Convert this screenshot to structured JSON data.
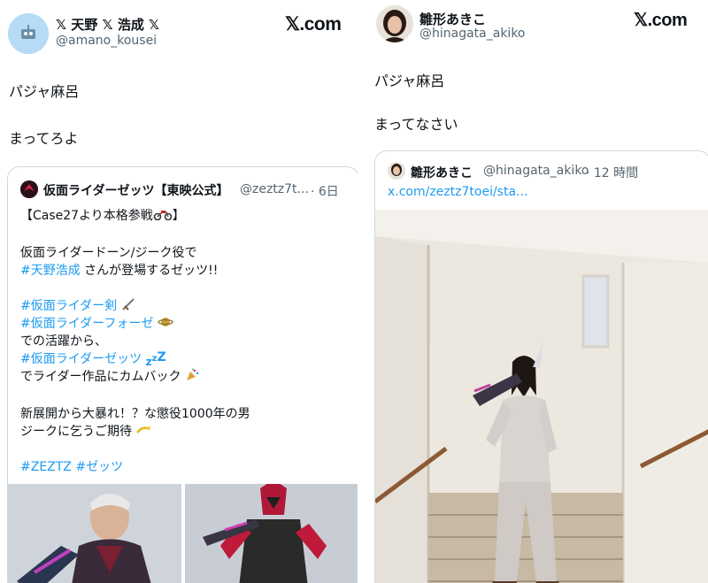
{
  "left_post": {
    "display_name": "𝕏 天野 𝕏 浩成 𝕏",
    "handle": "@amano_kousei",
    "brand": "𝕏.com",
    "text_lines": [
      "パジャ麻呂",
      "まってろよ"
    ],
    "quote": {
      "display_name": "仮面ライダーゼッツ【東映公式】",
      "handle": "@zeztz7t...",
      "time": "· 6日",
      "line1": "【Case27より本格参戦",
      "line1_end": "】",
      "line2": "仮面ライダードーン/ジーク役で",
      "line3_tag": "#天野浩成",
      "line3_rest": " さんが登場するゼッツ!!",
      "line4_tag": "#仮面ライダー剣",
      "line5_tag": "#仮面ライダーフォーゼ",
      "line6": "での活躍から、",
      "line7_tag": "#仮面ライダーゼッツ",
      "line8": "でライダー作品にカムバック",
      "line9": "新展開から大暴れ！？な懲役1000年の男",
      "line10": "ジークに乞うご期待",
      "line11_tags": "#ZEZTZ #ゼッツ"
    }
  },
  "right_post": {
    "display_name": "雛形あきこ",
    "handle": "@hinagata_akiko",
    "brand": "𝕏.com",
    "text_lines": [
      "パジャ麻呂",
      "まってなさい"
    ],
    "quote": {
      "display_name": "雛形あきこ",
      "handle": "@hinagata_akiko",
      "time": "· 12 時間",
      "link": "x.com/zeztz7toei/sta..."
    }
  },
  "colors": {
    "link": "#1d9bf0",
    "secondary": "#536471",
    "border": "#cfd9de"
  }
}
